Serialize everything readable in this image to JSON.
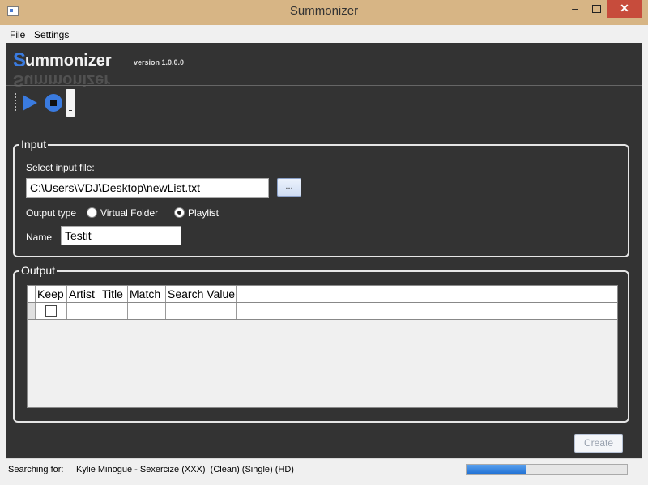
{
  "window": {
    "title": "Summonizer",
    "minimize": "–",
    "close": "✕"
  },
  "menu": {
    "items": [
      "File",
      "Settings"
    ]
  },
  "logo": {
    "s": "S",
    "rest": "ummonizer",
    "version": "version 1.0.0.0"
  },
  "input": {
    "group_title": "Input",
    "select_label": "Select input file:",
    "file_path": "C:\\Users\\VDJ\\Desktop\\newList.txt",
    "browse_label": "...",
    "output_type_label": "Output type",
    "option_virtual": "Virtual Folder",
    "option_playlist": "Playlist",
    "selected_option": "Playlist",
    "name_label": "Name",
    "name_value": "Testit"
  },
  "output": {
    "group_title": "Output",
    "columns": [
      "Keep",
      "Artist",
      "Title",
      "Match",
      "Search Value"
    ],
    "rows": [
      {
        "keep": false,
        "artist": "",
        "title": "",
        "match": "",
        "search_value": ""
      }
    ]
  },
  "actions": {
    "create_label": "Create"
  },
  "status": {
    "label": "Searching for:",
    "value": "Kylie Minogue - Sexercize (XXX)  (Clean) (Single) (HD)",
    "progress_percent": 37
  },
  "colors": {
    "title_bar": "#d7b585",
    "panel": "#333333",
    "accent": "#3a7be0",
    "close": "#c74c3c"
  }
}
